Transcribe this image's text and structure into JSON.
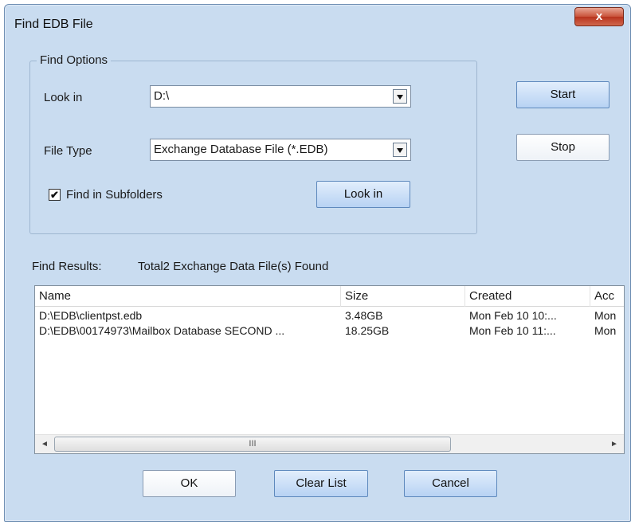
{
  "window": {
    "title": "Find EDB File",
    "close_glyph": "x"
  },
  "find_options": {
    "legend": "Find Options",
    "look_in_label": "Look in",
    "look_in_value": "D:\\",
    "file_type_label": "File Type",
    "file_type_value": "Exchange Database File (*.EDB)",
    "subfolders_label": "Find in Subfolders",
    "subfolders_checked": "✔",
    "look_in_button": "Look in"
  },
  "actions": {
    "start": "Start",
    "stop": "Stop"
  },
  "results": {
    "label": "Find Results:",
    "summary": "Total2 Exchange Data File(s) Found",
    "columns": [
      "Name",
      "Size",
      "Created",
      "Acc"
    ],
    "rows": [
      [
        "D:\\EDB\\clientpst.edb",
        "3.48GB",
        "Mon Feb 10 10:...",
        "Mon"
      ],
      [
        "D:\\EDB\\00174973\\Mailbox Database SECOND ...",
        "18.25GB",
        "Mon Feb 10 11:...",
        "Mon"
      ]
    ],
    "scroll_left": "◄",
    "scroll_right": "►",
    "scroll_grip": "III"
  },
  "footer": {
    "ok": "OK",
    "clear": "Clear List",
    "cancel": "Cancel"
  }
}
